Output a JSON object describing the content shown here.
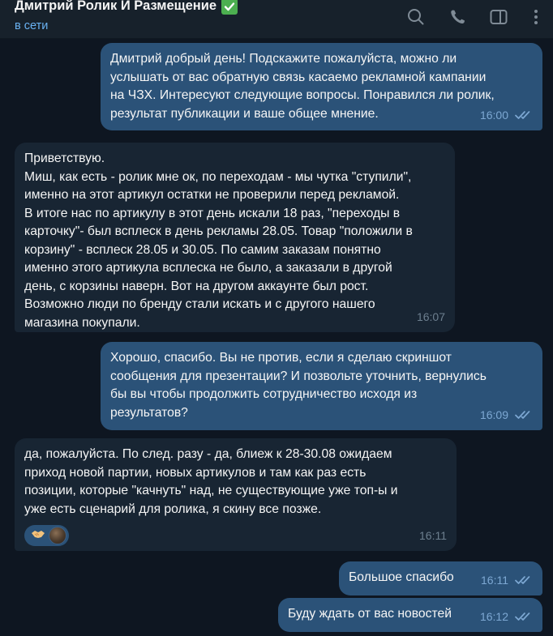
{
  "header": {
    "title": "Дмитрий Ролик И Размещение",
    "status": "в сети"
  },
  "messages": [
    {
      "direction": "out",
      "text": "Дмитрий добрый день! Подскажите пожалуйста, можно ли\nуслышать от вас обратную связь касаемо рекламной кампании\nна ЧЗХ. Интересуют следующие вопросы. Понравился ли ролик,\nрезультат публикации и ваше общее мнение.",
      "time": "16:00",
      "read": true
    },
    {
      "direction": "in",
      "text": "Приветствую.\nМиш, как есть - ролик мне ок, по переходам - мы чутка \"ступили\",\nименно на этот артикул остатки не проверили перед рекламой.\nВ итоге нас по артикулу в этот день искали 18 раз, \"переходы в\nкарточку\"- был всплеск в день рекламы 28.05. Товар \"положили в\nкорзину\" - всплеск 28.05 и 30.05.  По самим заказам понятно\nименно этого артикула всплеска не было, а заказали в другой\nдень, с корзины наверн. Вот на другом аккаунте был рост.\nВозможно люди по бренду стали искать и с другого нашего\nмагазина покупали.",
      "time": "16:07"
    },
    {
      "direction": "out",
      "text": "Хорошо, спасибо. Вы не против, если я сделаю скриншот\nсообщения для презентации? И позвольте уточнить, вернулись\nбы вы чтобы продолжить сотрудничество исходя из\nрезультатов?",
      "time": "16:09",
      "read": true
    },
    {
      "direction": "in",
      "text": "да, пожалуйста. По след. разу - да, блиеж к 28-30.08 ожидаем\nприход новой партии, новых артикулов и там как раз есть\nпозиции, которые \"качнуть\" над, не существующие уже топ-ы и\nуже есть сценарий для ролика, я скину все позже.",
      "time": "16:11",
      "reaction": "handshake"
    },
    {
      "direction": "out",
      "text": "Большое спасибо",
      "time": "16:11",
      "read": true
    },
    {
      "direction": "out",
      "text": "Буду ждать от вас новостей",
      "time": "16:12",
      "read": true
    }
  ],
  "icons": {
    "verified": "check-badge-icon",
    "search": "search-icon",
    "call": "phone-icon",
    "sidebar": "sidebar-toggle-icon",
    "menu": "more-vertical-icon",
    "read_receipt": "double-check-icon",
    "reaction": "handshake-icon"
  },
  "colors": {
    "background": "#0e1621",
    "header": "#17212b",
    "outgoing_bubble": "#2b5278",
    "incoming_bubble": "#182533",
    "status_blue": "#6ab2f2",
    "verified_green": "#4caf50"
  }
}
